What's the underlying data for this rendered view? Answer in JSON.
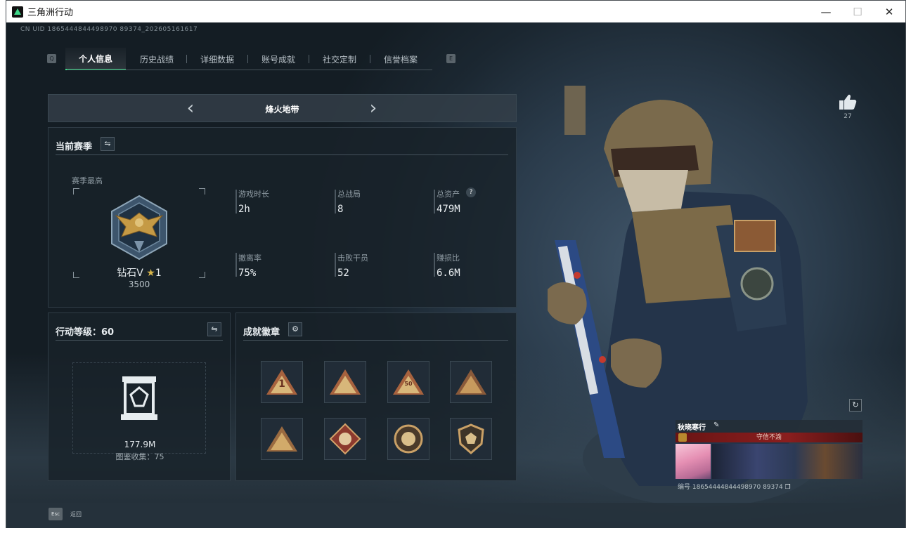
{
  "window": {
    "title": "三角洲行动",
    "controls": {
      "minimize": "—",
      "maximize": "☐",
      "close": "✕"
    }
  },
  "uid_top": "CN UID 1865444844498970 89374_202605161617",
  "tabs": {
    "prev_key": "Q",
    "next_key": "E",
    "items": [
      "个人信息",
      "历史战绩",
      "详细数据",
      "账号成就",
      "社交定制",
      "信誉档案"
    ],
    "active": 0
  },
  "mode_selector": {
    "label": "烽火地带",
    "prev": "‹",
    "next": "›"
  },
  "season": {
    "title": "当前赛季",
    "switch_icon": "swap-icon",
    "best_label": "赛季最高",
    "rank_name": "钻石V",
    "rank_star": "★",
    "rank_level": "1",
    "rank_points": "3500",
    "stats": [
      {
        "label": "游戏时长",
        "value": "2h"
      },
      {
        "label": "总战局",
        "value": "8"
      },
      {
        "label": "总资产",
        "value": "479M",
        "help": "?"
      },
      {
        "label": "撤离率",
        "value": "75%"
      },
      {
        "label": "击败干员",
        "value": "52"
      },
      {
        "label": "赚损比",
        "value": "6.6M"
      }
    ]
  },
  "level": {
    "title": "行动等级：60",
    "value": "177.9M",
    "collection": "图鉴收集：75"
  },
  "achievements": {
    "title": "成就徽章",
    "settings_icon": "gear-icon",
    "badges": [
      "1",
      "",
      "50",
      "",
      "",
      "",
      "",
      ""
    ]
  },
  "like": {
    "icon": "thumbs-up-icon",
    "count": "27"
  },
  "player_card": {
    "name": "秋晓寒行",
    "edit_icon": "pencil-icon",
    "motto": "守信不渝",
    "uid": "编号 18654444844498970 89374"
  },
  "bottom": {
    "esc_key": "Esc",
    "esc_label": "返回"
  },
  "colors": {
    "accent": "#3fd98a",
    "panel": "#18222a",
    "motto_bg": "#8a1e1e"
  }
}
